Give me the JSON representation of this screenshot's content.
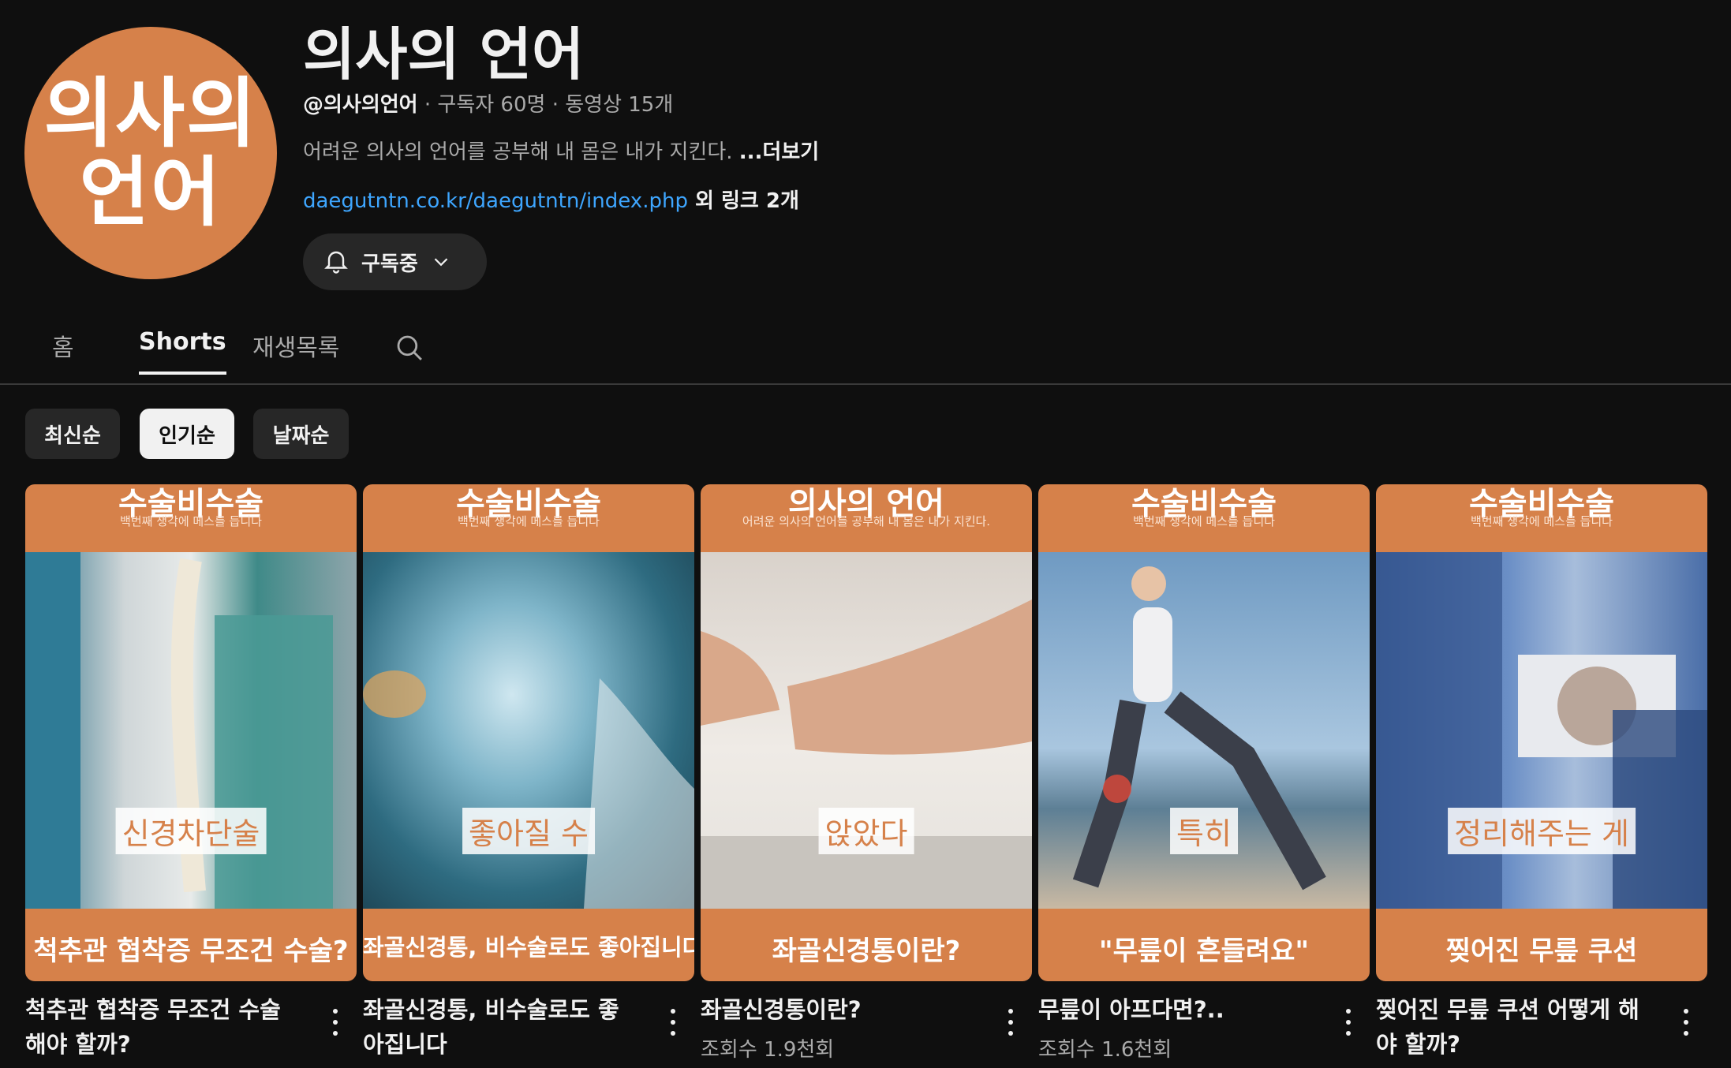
{
  "channel": {
    "avatar_line1": "의사의",
    "avatar_line2": "언어",
    "title": "의사의 언어",
    "handle": "@의사의언어",
    "meta_rest": " · 구독자 60명 · 동영상 15개",
    "description": "어려운 의사의 언어를 공부해 내 몸은 내가 지킨다. ",
    "more_label": "...더보기",
    "link_url": "daegutntn.co.kr/daegutntn/index.php",
    "link_extra": " 외 링크 2개",
    "subscribe_label": "구독중"
  },
  "tabs": [
    {
      "label": "홈"
    },
    {
      "label": "Shorts",
      "active": true
    },
    {
      "label": "재생목록"
    }
  ],
  "chips": [
    {
      "label": "최신순"
    },
    {
      "label": "인기순",
      "active": true
    },
    {
      "label": "날짜순"
    }
  ],
  "shorts": [
    {
      "thumb_top_title": "수술비수술",
      "thumb_top_sub": "백번째 생각에 메스를 듭니다",
      "thumb_caption": "신경차단술",
      "thumb_bottom": "척추관 협착증 무조건 수술?",
      "title_line1": "척추관 협착증 무조건 수술",
      "title_line2": "해야 할까?",
      "views": ""
    },
    {
      "thumb_top_title": "수술비수술",
      "thumb_top_sub": "백번째 생각에 메스를 듭니다",
      "thumb_caption": "좋아질 수",
      "thumb_bottom": "좌골신경통, 비수술로도 좋아집니다",
      "title_line1": "좌골신경통, 비수술로도 좋",
      "title_line2": "아집니다",
      "views": ""
    },
    {
      "thumb_top_title": "의사의 언어",
      "thumb_top_sub": "어려운 의사의 언어를 공부해 내 몸은 내가 지킨다.",
      "thumb_caption": "앉았다",
      "thumb_bottom": "좌골신경통이란?",
      "title_line1": "좌골신경통이란?",
      "title_line2": "",
      "views": "조회수 1.9천회"
    },
    {
      "thumb_top_title": "수술비수술",
      "thumb_top_sub": "백번째 생각에 메스를 듭니다",
      "thumb_caption": "특히",
      "thumb_bottom": "\"무릎이 흔들려요\"",
      "title_line1": "무릎이 아프다면?..",
      "title_line2": "",
      "views": "조회수 1.6천회"
    },
    {
      "thumb_top_title": "수술비수술",
      "thumb_top_sub": "백번째 생각에 메스를 듭니다",
      "thumb_caption": "정리해주는 게",
      "thumb_bottom": "찢어진 무릎 쿠션",
      "title_line1": "찢어진 무릎 쿠션 어떻게 해",
      "title_line2": "야 할까?",
      "views": ""
    }
  ],
  "colors": {
    "background": "#0f0f0f",
    "brand_orange": "#d6814a",
    "link": "#3ea6ff",
    "chip_bg": "#272727"
  },
  "icons": [
    "bell-icon",
    "chevron-down-icon",
    "search-icon",
    "more-vert-icon"
  ]
}
